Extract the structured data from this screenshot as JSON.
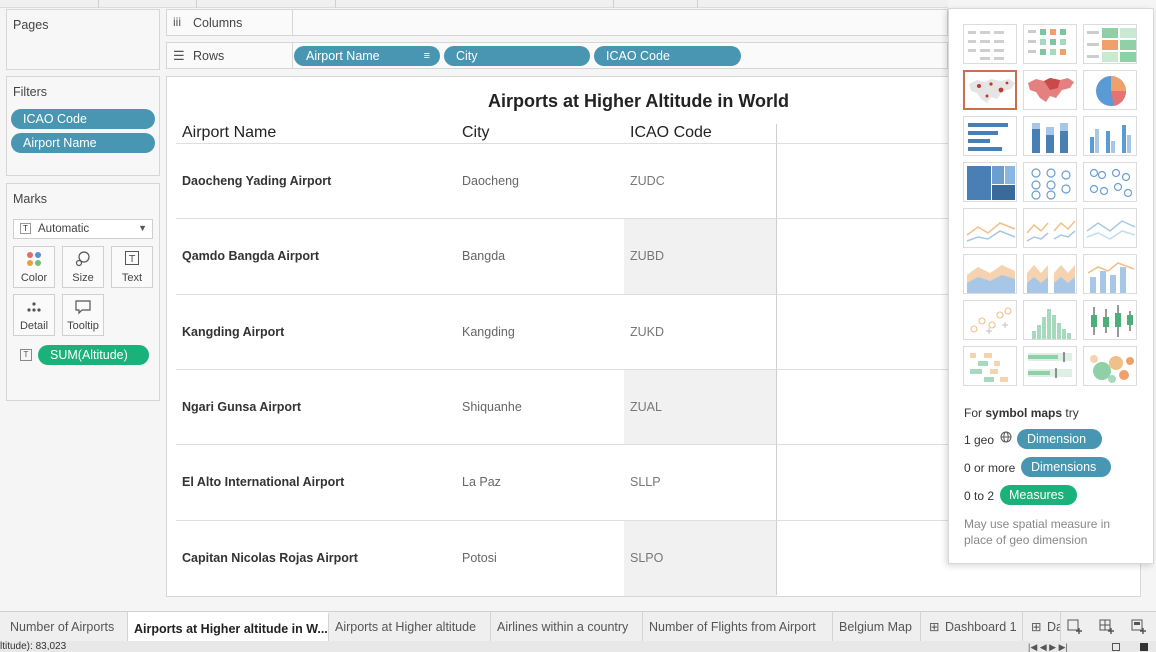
{
  "left": {
    "pages_title": "Pages",
    "filters_title": "Filters",
    "filters": [
      "ICAO Code",
      "Airport Name"
    ],
    "marks_title": "Marks",
    "mark_type": "Automatic",
    "mark_buttons": [
      "Color",
      "Size",
      "Text",
      "Detail",
      "Tooltip"
    ],
    "measure_pill": "SUM(Altitude)"
  },
  "shelves": {
    "columns_label": "Columns",
    "rows_label": "Rows",
    "row_pills": [
      "Airport Name",
      "City",
      "ICAO Code"
    ]
  },
  "view": {
    "title": "Airports at Higher Altitude in World",
    "headers": [
      "Airport Name",
      "City",
      "ICAO Code"
    ],
    "rows": [
      {
        "airport": "Daocheng Yading Airport",
        "city": "Daocheng",
        "icao": "ZUDC"
      },
      {
        "airport": "Qamdo Bangda Airport",
        "city": "Bangda",
        "icao": "ZUBD"
      },
      {
        "airport": "Kangding Airport",
        "city": "Kangding",
        "icao": "ZUKD"
      },
      {
        "airport": "Ngari Gunsa Airport",
        "city": "Shiquanhe",
        "icao": "ZUAL"
      },
      {
        "airport": "El Alto International Airport",
        "city": "La Paz",
        "icao": "SLLP"
      },
      {
        "airport": "Capitan Nicolas Rojas Airport",
        "city": "Potosi",
        "icao": "SLPO"
      }
    ]
  },
  "show_me": {
    "hint_prefix": "For",
    "hint_bold": "symbol maps",
    "hint_suffix": "try",
    "req1_label": "1 geo",
    "req1_pill": "Dimension",
    "req2_label": "0 or more",
    "req2_pill": "Dimensions",
    "req3_label": "0 to 2",
    "req3_pill": "Measures",
    "note_line1": "May use spatial measure in",
    "note_line2": "place of geo dimension"
  },
  "tabs": [
    "Number of Airports",
    "Airports at Higher altitude in W...",
    "Airports at Higher altitude",
    "Airlines within a country",
    "Number of Flights from Airport",
    "Belgium Map",
    "Dashboard 1",
    "Da"
  ],
  "status_text": "ltitude): 83,023",
  "colors": {
    "pill_blue": "#4996b2",
    "pill_green": "#1bb17b",
    "selected_border": "#c8704a"
  }
}
